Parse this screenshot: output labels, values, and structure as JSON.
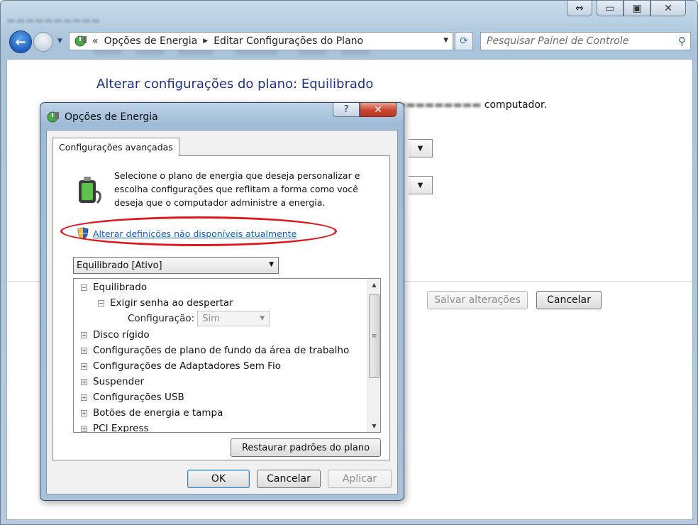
{
  "window": {
    "breadcrumbs": [
      "Opções de Energia",
      "Editar Configurações do Plano"
    ],
    "breadcrumb_prefix": "«",
    "search_placeholder": "Pesquisar Painel de Controle"
  },
  "page": {
    "heading": "Alterar configurações do plano: Equilibrado",
    "subtext_visible": "computador.",
    "save_label": "Salvar alterações",
    "cancel_label": "Cancelar"
  },
  "dialog": {
    "title": "Opções de Energia",
    "help_label": "?",
    "close_label": "✕",
    "tab_label": "Configurações avançadas",
    "description": "Selecione o plano de energia que deseja personalizar e escolha configurações que reflitam a forma como você deseja que o computador administre a energia.",
    "change_link": "Alterar definições não disponíveis atualmente",
    "plan_select": "Equilibrado [Ativo]",
    "tree": {
      "root": "Equilibrado",
      "child": "Exigir senha ao despertar",
      "config_label": "Configuração:",
      "config_value": "Sim",
      "items": [
        "Disco rígido",
        "Configurações de plano de fundo da área de trabalho",
        "Configurações de Adaptadores Sem Fio",
        "Suspender",
        "Configurações USB",
        "Botões de energia e tampa",
        "PCI Express"
      ]
    },
    "restore_label": "Restaurar padrões do plano",
    "ok_label": "OK",
    "cancel_label": "Cancelar",
    "apply_label": "Aplicar"
  },
  "colors": {
    "heading": "#1e3287",
    "link": "#0f5ec7",
    "highlight_ellipse": "#e0161e",
    "close_button": "#c9452f"
  },
  "icons": [
    "back-arrow-icon",
    "forward-arrow-icon",
    "power-options-icon",
    "refresh-icon",
    "search-icon",
    "help-icon",
    "close-icon",
    "battery-plug-icon",
    "uac-shield-icon",
    "tree-expand-icon",
    "tree-collapse-icon"
  ]
}
